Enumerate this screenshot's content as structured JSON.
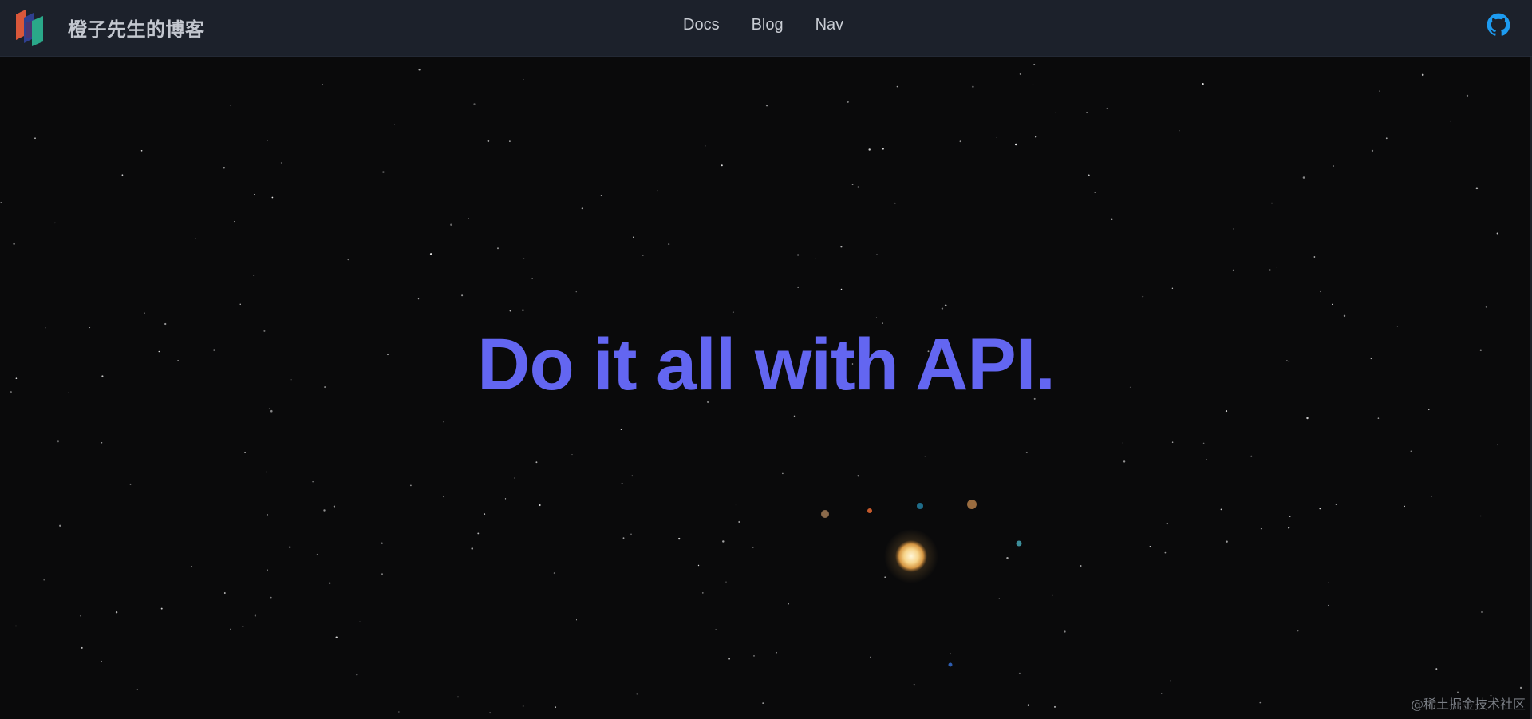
{
  "header": {
    "brand_title": "橙子先生的博客",
    "nav": [
      {
        "label": "Docs"
      },
      {
        "label": "Blog"
      },
      {
        "label": "Nav"
      }
    ],
    "github_icon": "github-icon"
  },
  "hero": {
    "title": "Do it all with API."
  },
  "watermark": "@稀土掘金技术社区",
  "colors": {
    "background": "#0a0a0b",
    "navbar": "#1c212b",
    "accent": "#6366f1",
    "github": "#1d9bf0"
  }
}
